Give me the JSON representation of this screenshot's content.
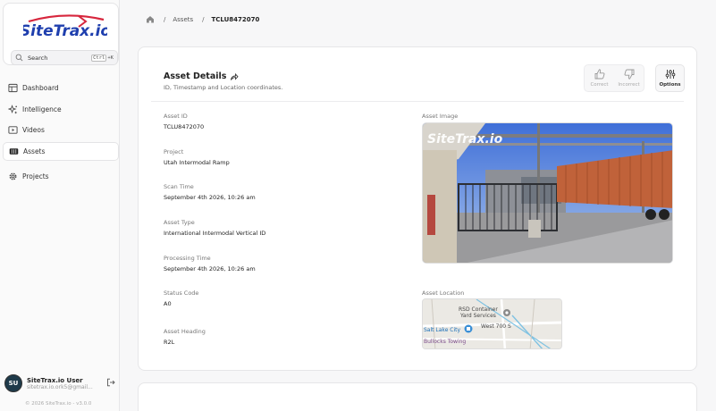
{
  "sidebar": {
    "logo_text": "SiteTrax.io",
    "search": {
      "label": "Search",
      "key1": "Ctrl",
      "key2": "+K"
    },
    "items": [
      {
        "label": "Dashboard",
        "icon": "dashboard-icon"
      },
      {
        "label": "Intelligence",
        "icon": "sparkles-icon"
      },
      {
        "label": "Videos",
        "icon": "video-icon"
      },
      {
        "label": "Assets",
        "icon": "container-icon",
        "active": true
      },
      {
        "label": "Projects",
        "icon": "gear-icon"
      }
    ],
    "user": {
      "initials": "SU",
      "name": "SiteTrax.io User",
      "email": "sitetrax.io.ork5@gmail..."
    },
    "copyright": "© 2026 SiteTrax.io - v3.0.0"
  },
  "breadcrumb": {
    "sep1": "/",
    "assets": "Assets",
    "sep2": "/",
    "current": "TCLU8472070"
  },
  "card": {
    "title": "Asset Details",
    "subtitle": "ID, Timestamp and Location coordinates.",
    "actions": {
      "correct": "Correct",
      "incorrect": "Incorrect",
      "options": "Options"
    },
    "fields": [
      {
        "label": "Asset ID",
        "value": "TCLU8472070"
      },
      {
        "label": "Project",
        "value": "Utah Intermodal Ramp"
      },
      {
        "label": "Scan Time",
        "value": "September 4th 2026, 10:26 am"
      },
      {
        "label": "Asset Type",
        "value": "International Intermodal Vertical ID"
      },
      {
        "label": "Processing Time",
        "value": "September 4th 2026, 10:26 am"
      },
      {
        "label": "Status Code",
        "value": "A0"
      },
      {
        "label": "Asset Heading",
        "value": "R2L"
      }
    ],
    "image_label": "Asset Image",
    "image_watermark": "SiteTrax.io",
    "location_label": "Asset Location",
    "map": {
      "place1": "RSD Container",
      "place2": "Yard Services",
      "street": "West 700 S",
      "city": "Salt Lake City",
      "business": "Bullocks Towing"
    }
  },
  "colors": {
    "accent": "#1f3fae",
    "logo_red": "#d7263d",
    "avatar": "#1e3a4a"
  }
}
